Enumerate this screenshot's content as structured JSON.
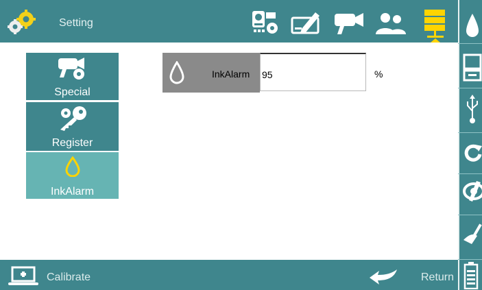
{
  "header": {
    "title": "Setting"
  },
  "menu": [
    {
      "label": "Special",
      "icon": "camera-gear-icon",
      "active": false
    },
    {
      "label": "Register",
      "icon": "keys-gear-icon",
      "active": false
    },
    {
      "label": "InkAlarm",
      "icon": "ink-drop-icon",
      "active": true
    }
  ],
  "field": {
    "label": "InkAlarm",
    "value": "95",
    "unit": "%"
  },
  "footer": {
    "calibrate_label": "Calibrate",
    "return_label": "Return"
  },
  "colors": {
    "bar": "#3f868d",
    "active_item": "#66b4b3",
    "active_icon": "#ffd400"
  }
}
